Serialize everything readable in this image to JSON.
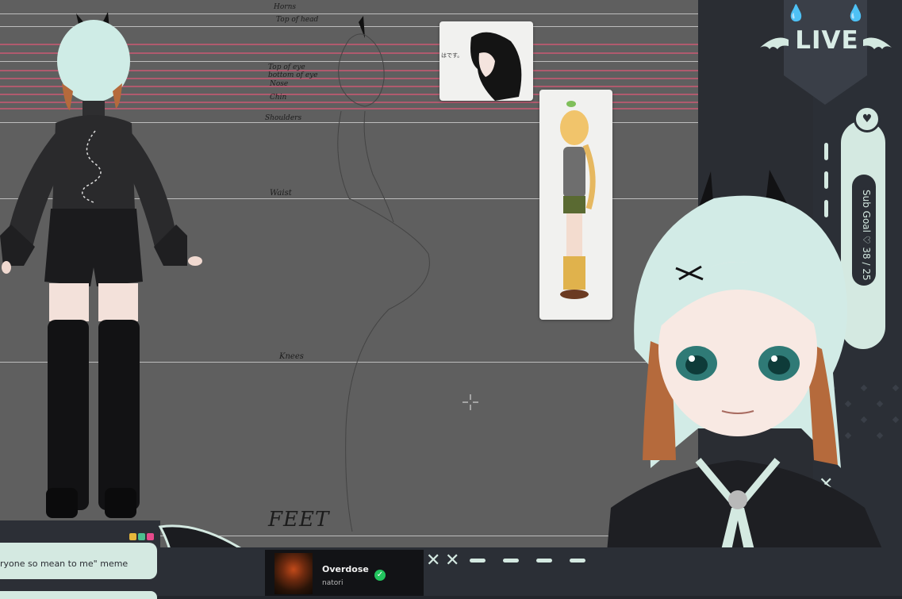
{
  "guide_labels": {
    "horns": "Horns",
    "top_of_head": "Top of head",
    "top_of_eye": "Top of eye",
    "bottom_of_eye": "bottom of eye",
    "nose": "Nose",
    "chin": "Chin",
    "shoulders": "Shoulders",
    "waist": "Waist",
    "knees": "Knees",
    "feet": "FEET"
  },
  "reference_card": {
    "japanese_text": "はです。"
  },
  "overlay": {
    "live_label": "LIVE",
    "sub_goal": "Sub Goal ♡ 38 / 25"
  },
  "chat": {
    "message": "ryone so mean to me\" meme"
  },
  "now_playing": {
    "title": "Overdose",
    "artist": "natori",
    "check": "✓"
  },
  "colors": {
    "accent": "#d4e9e1",
    "panel": "#2b2f36",
    "canvas": "#5f5f5f",
    "guide_red": "#b05a6e",
    "spotify_green": "#22c55e"
  },
  "icons": [
    "droplet-icon",
    "bat-wing-icon",
    "heart-icon",
    "x-mark-icon",
    "crosshair-icon",
    "check-icon"
  ]
}
